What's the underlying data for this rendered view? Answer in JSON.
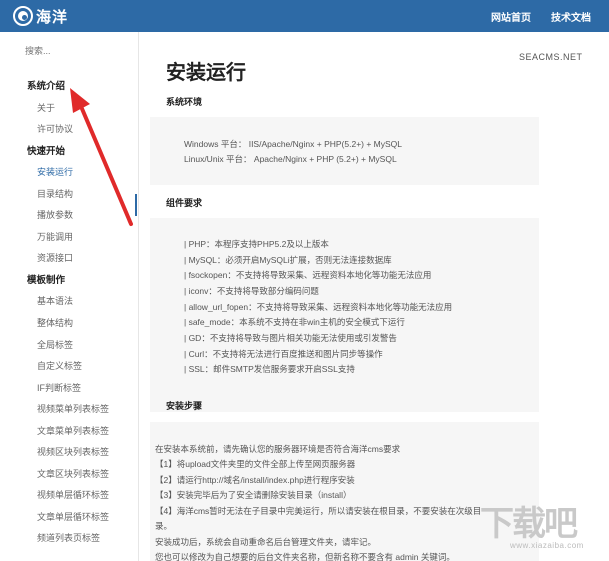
{
  "header": {
    "logo_text": "海洋",
    "nav": [
      {
        "label": "网站首页"
      },
      {
        "label": "技术文档"
      }
    ]
  },
  "sidebar": {
    "search_placeholder": "搜索...",
    "groups": [
      {
        "label": "系统介绍",
        "items": [
          "关于",
          "许可协议"
        ]
      },
      {
        "label": "快速开始",
        "items": [
          "安装运行",
          "目录结构",
          "播放参数",
          "万能调用",
          "资源接口"
        ]
      },
      {
        "label": "模板制作",
        "items": [
          "基本语法",
          "整体结构",
          "全局标签",
          "自定义标签",
          "IF判断标签",
          "视频菜单列表标签",
          "文章菜单列表标签",
          "视频区块列表标签",
          "文章区块列表标签",
          "视频单层循环标签",
          "文章单层循环标签",
          "频道列表页标签"
        ]
      }
    ],
    "active_item": "安装运行"
  },
  "content": {
    "brand": "SEACMS.NET",
    "title": "安装运行",
    "sections": [
      {
        "title": "系统环境",
        "lines": [
          "Windows 平台：  IIS/Apache/Nginx + PHP(5.2+) + MySQL",
          "Linux/Unix 平台：  Apache/Nginx + PHP (5.2+) + MySQL"
        ]
      },
      {
        "title": "组件要求",
        "lines": [
          "| PHP：本程序支持PHP5.2及以上版本",
          "| MySQL：必须开启MySQLi扩展，否则无法连接数据库",
          "| fsockopen：不支持将导致采集、远程资料本地化等功能无法应用",
          "| iconv：不支持将导致部分编码问题",
          "| allow_url_fopen：不支持将导致采集、远程资料本地化等功能无法应用",
          "| safe_mode：本系统不支持在非win主机的安全模式下运行",
          "| GD：不支持将导致与图片相关功能无法使用或引发警告",
          "| Curl：不支持将无法进行百度推送和图片同步等操作",
          "| SSL：邮件SMTP发信服务要求开启SSL支持"
        ]
      },
      {
        "title": "安装步骤",
        "lines": [
          "在安装本系统前，请先确认您的服务器环境是否符合海洋cms要求",
          "【1】将upload文件夹里的文件全部上传至网页服务器",
          "【2】请运行http://域名/install/index.php进行程序安装",
          "【3】安装完毕后为了安全请删除安装目录（install）",
          "【4】海洋cms暂时无法在子目录中完美运行，所以请安装在根目录，不要安装在次级目",
          "录。",
          "安装成功后，系统会自动重命名后台管理文件夹，请牢记。",
          "您也可以修改为自己想要的后台文件夹名称，但新名称不要含有 admin 关键词。"
        ]
      }
    ]
  },
  "annotation": {
    "arrow_color": "#e02a2a"
  },
  "watermark": {
    "glyphs": "下载吧",
    "sub": "www.xiazaiba.com"
  }
}
